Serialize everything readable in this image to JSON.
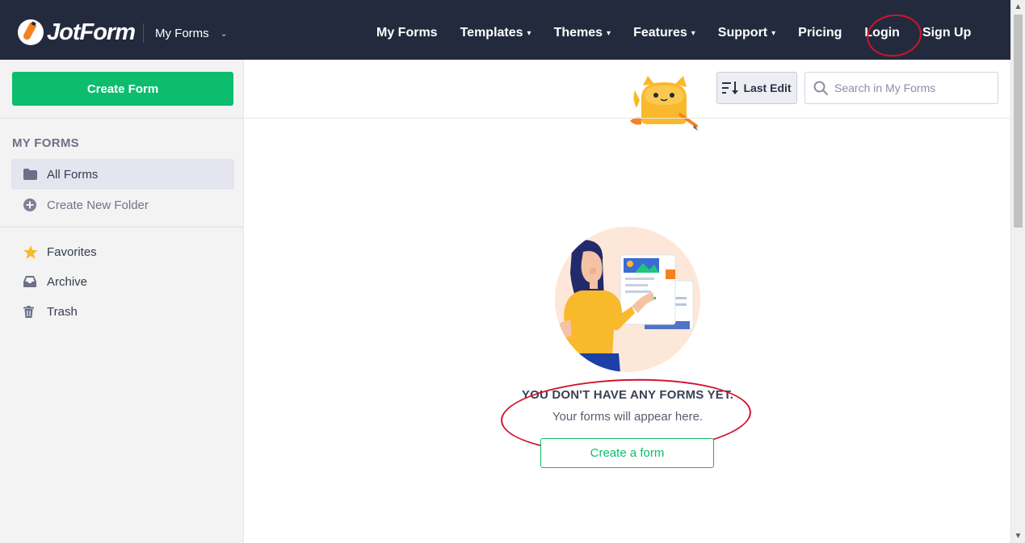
{
  "header": {
    "logo_text": "JotForm",
    "switcher_label": "My Forms",
    "nav": [
      {
        "label": "My Forms",
        "has_caret": false
      },
      {
        "label": "Templates",
        "has_caret": true
      },
      {
        "label": "Themes",
        "has_caret": true
      },
      {
        "label": "Features",
        "has_caret": true
      },
      {
        "label": "Support",
        "has_caret": true
      },
      {
        "label": "Pricing",
        "has_caret": false
      },
      {
        "label": "Login",
        "has_caret": false
      },
      {
        "label": "Sign Up",
        "has_caret": false
      }
    ],
    "caret_glyph": "▾"
  },
  "sidebar": {
    "create_button_label": "Create Form",
    "section_title": "MY FORMS",
    "folders": [
      {
        "label": "All Forms",
        "icon": "folder-icon",
        "active": true
      },
      {
        "label": "Create New Folder",
        "icon": "plus-circle-icon",
        "active": false
      }
    ],
    "items": [
      {
        "label": "Favorites",
        "icon": "star-icon"
      },
      {
        "label": "Archive",
        "icon": "inbox-icon"
      },
      {
        "label": "Trash",
        "icon": "trash-icon"
      }
    ]
  },
  "toolbar": {
    "sort_label": "Last Edit",
    "search_placeholder": "Search in My Forms"
  },
  "empty_state": {
    "title": "YOU DON'T HAVE ANY FORMS YET.",
    "subtitle": "Your forms will appear here.",
    "button_label": "Create a form"
  },
  "colors": {
    "topbar": "#232a3d",
    "primary_green": "#0bbd6d",
    "annotation_red": "#d0142c",
    "sidebar_bg": "#f3f3f3",
    "accent_orange": "#f58220",
    "favorite_star": "#f9b92c"
  }
}
